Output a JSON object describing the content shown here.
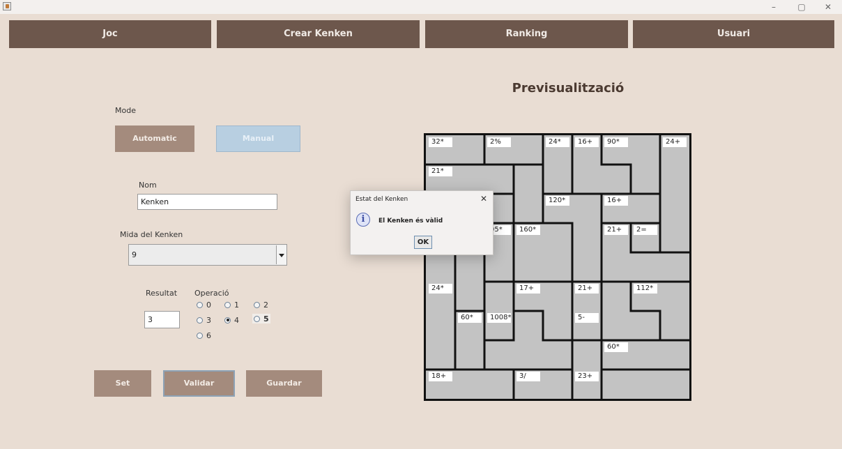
{
  "window": {
    "minimize": "–",
    "maximize": "▢",
    "close": "✕"
  },
  "nav": {
    "tabs": [
      "Joc",
      "Crear Kenken",
      "Ranking",
      "Usuari"
    ]
  },
  "form": {
    "mode_label": "Mode",
    "mode_automatic": "Automatic",
    "mode_manual": "Manual",
    "nom_label": "Nom",
    "nom_value": "Kenken",
    "mida_label": "Mida del Kenken",
    "mida_value": "9",
    "resultat_label": "Resultat",
    "resultat_value": "3",
    "operacio_label": "Operació",
    "operacio_options": [
      "0",
      "1",
      "2",
      "3",
      "4",
      "5",
      "6"
    ],
    "operacio_selected": "4",
    "btn_set": "Set",
    "btn_validar": "Validar",
    "btn_guardar": "Guardar"
  },
  "preview": {
    "title": "Previsualització",
    "size": 9,
    "cells": [
      [
        1,
        1,
        2,
        2,
        3,
        4,
        5,
        5,
        6
      ],
      [
        7,
        7,
        7,
        8,
        3,
        4,
        4,
        5,
        6
      ],
      [
        7,
        9,
        9,
        8,
        10,
        10,
        11,
        11,
        6
      ],
      [
        7,
        9,
        12,
        13,
        13,
        10,
        14,
        15,
        6
      ],
      [
        16,
        9,
        12,
        13,
        13,
        10,
        14,
        14,
        14
      ],
      [
        16,
        9,
        18,
        19,
        19,
        20,
        21,
        22,
        22
      ],
      [
        16,
        23,
        18,
        24,
        19,
        20,
        21,
        21,
        22
      ],
      [
        16,
        23,
        24,
        24,
        24,
        25,
        26,
        26,
        26
      ],
      [
        27,
        27,
        27,
        28,
        28,
        25,
        29,
        29,
        29
      ]
    ],
    "labels": [
      {
        "r": 0,
        "c": 0,
        "t": "32*"
      },
      {
        "r": 0,
        "c": 2,
        "t": "2%"
      },
      {
        "r": 0,
        "c": 4,
        "t": "24*"
      },
      {
        "r": 0,
        "c": 5,
        "t": "16+"
      },
      {
        "r": 0,
        "c": 6,
        "t": "90*"
      },
      {
        "r": 0,
        "c": 8,
        "t": "24+"
      },
      {
        "r": 1,
        "c": 0,
        "t": "21*"
      },
      {
        "r": 2,
        "c": 4,
        "t": "120*"
      },
      {
        "r": 2,
        "c": 6,
        "t": "16+"
      },
      {
        "r": 3,
        "c": 2,
        "t": "05*"
      },
      {
        "r": 3,
        "c": 3,
        "t": "160*"
      },
      {
        "r": 3,
        "c": 6,
        "t": "21+"
      },
      {
        "r": 3,
        "c": 7,
        "t": "2="
      },
      {
        "r": 5,
        "c": 0,
        "t": "24*"
      },
      {
        "r": 5,
        "c": 3,
        "t": "17+"
      },
      {
        "r": 5,
        "c": 5,
        "t": "21+"
      },
      {
        "r": 5,
        "c": 7,
        "t": "112*"
      },
      {
        "r": 6,
        "c": 1,
        "t": "60*"
      },
      {
        "r": 6,
        "c": 2,
        "t": "1008*"
      },
      {
        "r": 6,
        "c": 5,
        "t": "5-"
      },
      {
        "r": 7,
        "c": 6,
        "t": "60*"
      },
      {
        "r": 8,
        "c": 0,
        "t": "18+"
      },
      {
        "r": 8,
        "c": 3,
        "t": "3/"
      },
      {
        "r": 8,
        "c": 5,
        "t": "23+"
      }
    ]
  },
  "dialog": {
    "title": "Estat del Kenken",
    "close": "✕",
    "icon": "info-icon",
    "message": "El Kenken és vàlid",
    "ok": "OK"
  }
}
